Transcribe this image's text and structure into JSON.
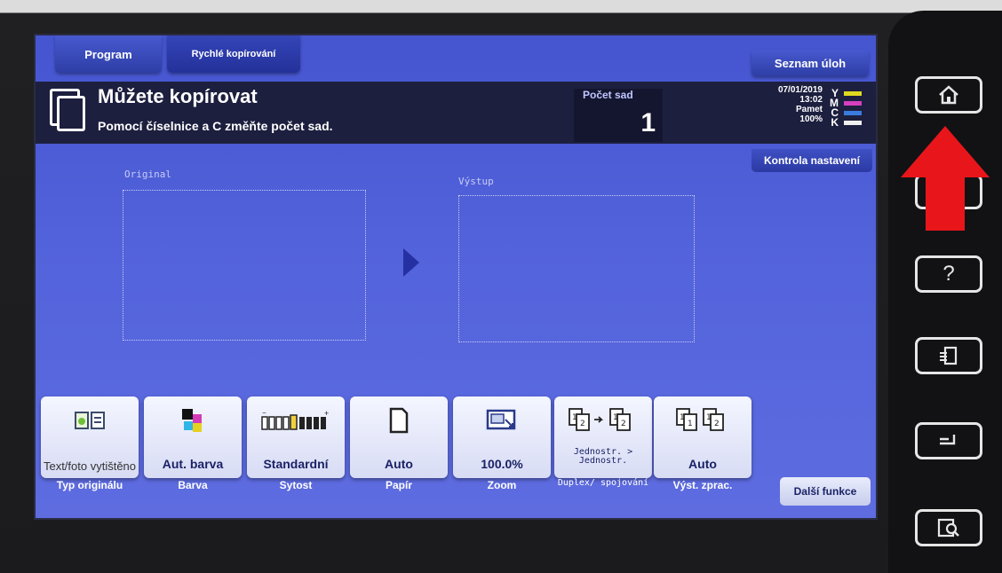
{
  "tabs": {
    "program": "Program",
    "quick_copy": "Rychlé kopírování",
    "jobs": "Seznam úloh"
  },
  "header": {
    "title": "Můžete kopírovat",
    "instruction": "Pomocí číselnice a C změňte počet sad.",
    "sets_label": "Počet sad",
    "sets_value": "1",
    "date": "07/01/2019",
    "time": "13:02",
    "memory_label": "Pamet",
    "memory_value": "100%",
    "ink": [
      {
        "label": "Y",
        "color": "#e0d820"
      },
      {
        "label": "M",
        "color": "#d440c0"
      },
      {
        "label": "C",
        "color": "#3a7be0"
      },
      {
        "label": "K",
        "color": "#f0f0f0"
      }
    ]
  },
  "check_settings": "Kontrola nastavení",
  "preview": {
    "original_label": "Original",
    "output_label": "Výstup"
  },
  "functions": [
    {
      "value": "Text/foto vytištěno",
      "caption": "Typ originálu",
      "icon": "book-icon"
    },
    {
      "value": "Aut. barva",
      "caption": "Barva",
      "icon": "color-squares-icon"
    },
    {
      "value": "Standardní",
      "caption": "Sytost",
      "icon": "density-icon"
    },
    {
      "value": "Auto",
      "caption": "Papír",
      "icon": "paper-icon"
    },
    {
      "value": "100.0%",
      "caption": "Zoom",
      "icon": "zoom-icon"
    },
    {
      "value": "Jednostr. > Jednostr.",
      "caption": "Duplex/ spojování",
      "icon": "duplex-icon"
    },
    {
      "value": "Auto",
      "caption": "Výst. zprac.",
      "icon": "finishing-icon"
    }
  ],
  "more_functions": "Další funkce",
  "hardware": {
    "help_glyph": "?"
  },
  "colors": {
    "screen": "#5363db",
    "header": "#1d1f3f",
    "arrow": "#e8161a"
  }
}
